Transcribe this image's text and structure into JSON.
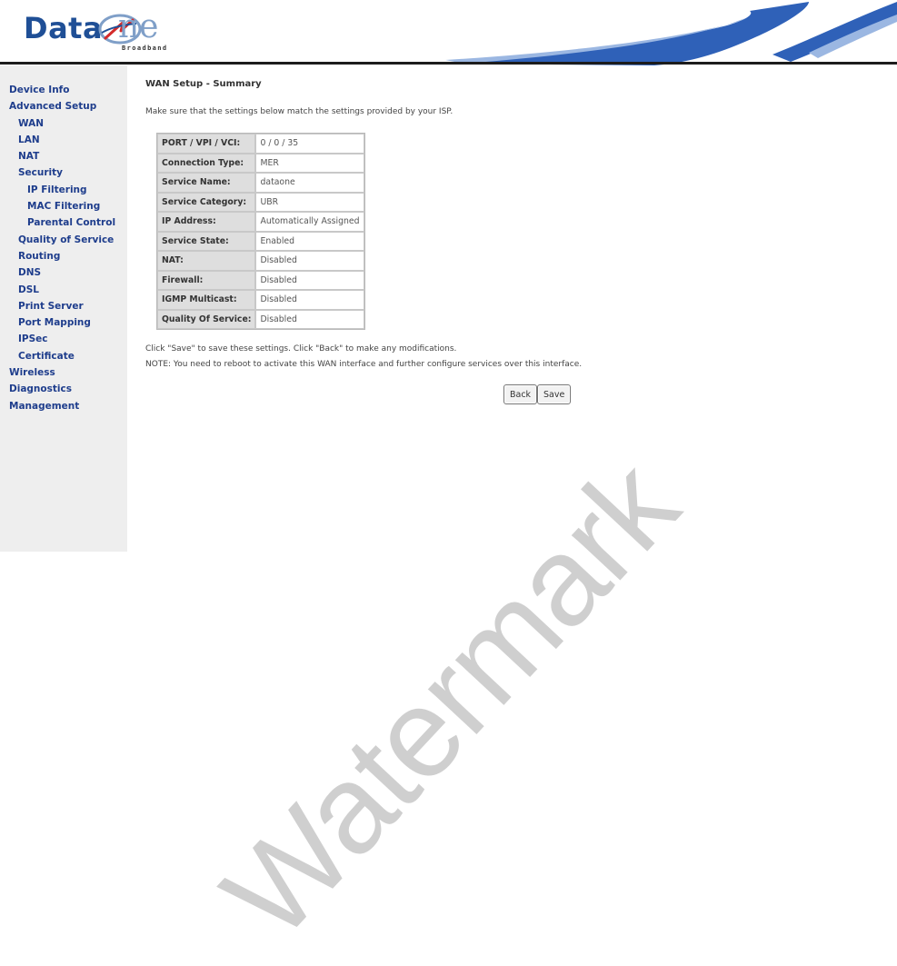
{
  "header": {
    "logo_main": "Data",
    "logo_suffix": "ne",
    "logo_sub": "Broadband"
  },
  "sidebar": {
    "items": [
      {
        "label": "Device Info",
        "level": 0
      },
      {
        "label": "Advanced Setup",
        "level": 0
      },
      {
        "label": "WAN",
        "level": 1
      },
      {
        "label": "LAN",
        "level": 1
      },
      {
        "label": "NAT",
        "level": 1
      },
      {
        "label": "Security",
        "level": 1
      },
      {
        "label": "IP Filtering",
        "level": 2
      },
      {
        "label": "MAC Filtering",
        "level": 2
      },
      {
        "label": "Parental Control",
        "level": 2
      },
      {
        "label": "Quality of Service",
        "level": 1
      },
      {
        "label": "Routing",
        "level": 1
      },
      {
        "label": "DNS",
        "level": 1
      },
      {
        "label": "DSL",
        "level": 1
      },
      {
        "label": "Print Server",
        "level": 1
      },
      {
        "label": "Port Mapping",
        "level": 1
      },
      {
        "label": "IPSec",
        "level": 1
      },
      {
        "label": "Certificate",
        "level": 1
      },
      {
        "label": "Wireless",
        "level": 0
      },
      {
        "label": "Diagnostics",
        "level": 0
      },
      {
        "label": "Management",
        "level": 0
      }
    ]
  },
  "main": {
    "title": "WAN Setup - Summary",
    "intro": "Make sure that the settings below match the settings provided by your ISP.",
    "summary": [
      {
        "label": "PORT / VPI / VCI:",
        "value": "0 / 0 / 35"
      },
      {
        "label": "Connection Type:",
        "value": "MER"
      },
      {
        "label": "Service Name:",
        "value": "dataone"
      },
      {
        "label": "Service Category:",
        "value": "UBR"
      },
      {
        "label": "IP Address:",
        "value": "Automatically Assigned"
      },
      {
        "label": "Service State:",
        "value": "Enabled"
      },
      {
        "label": "NAT:",
        "value": "Disabled"
      },
      {
        "label": "Firewall:",
        "value": "Disabled"
      },
      {
        "label": "IGMP Multicast:",
        "value": "Disabled"
      },
      {
        "label": "Quality Of Service:",
        "value": "Disabled"
      }
    ],
    "note1": "Click \"Save\" to save these settings. Click \"Back\" to make any modifications.",
    "note2": "NOTE: You need to reboot to activate this WAN interface and further configure services over this interface.",
    "back_label": "Back",
    "save_label": "Save"
  },
  "watermark": "Watermark",
  "colors": {
    "nav_link": "#1e3d8c",
    "logo_blue": "#1f4f96",
    "sidebar_bg": "#eeeeee",
    "label_cell_bg": "#dedede",
    "header_rule": "#1c1c1c"
  }
}
